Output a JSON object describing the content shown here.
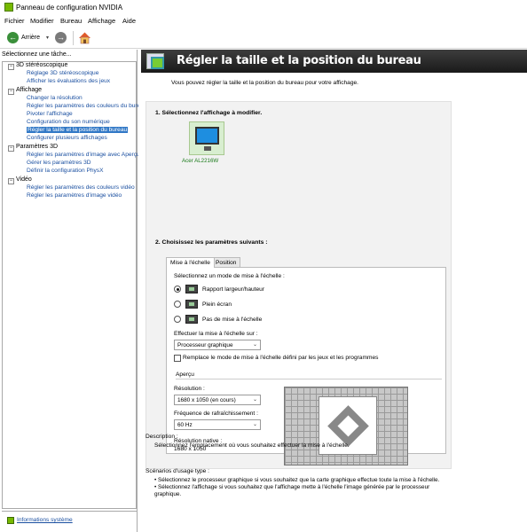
{
  "window": {
    "title": "Panneau de configuration NVIDIA"
  },
  "menu": [
    "Fichier",
    "Modifier",
    "Bureau",
    "Affichage",
    "Aide"
  ],
  "toolbar": {
    "back_label": "Arrière"
  },
  "sidebar": {
    "header": "Sélectionnez une tâche...",
    "categories": [
      {
        "label": "3D stéréoscopique",
        "items": [
          "Réglage 3D stéréoscopique",
          "Afficher les évaluations des jeux"
        ]
      },
      {
        "label": "Affichage",
        "items": [
          "Changer la résolution",
          "Régler les paramètres des couleurs du bureau",
          "Pivoter l'affichage",
          "Configuration du son numérique",
          "Régler la taille et la position du bureau",
          "Configurer plusieurs affichages"
        ]
      },
      {
        "label": "Paramètres 3D",
        "items": [
          "Régler les paramètres d'image avec Aperçu",
          "Gérer les paramètres 3D",
          "Définir la configuration PhysX"
        ]
      },
      {
        "label": "Vidéo",
        "items": [
          "Régler les paramètres des couleurs vidéo",
          "Régler les paramètres d'image vidéo"
        ]
      }
    ],
    "selected_item": "Régler la taille et la position du bureau",
    "system_info": "Informations système"
  },
  "page": {
    "title": "Régler la taille et la position du bureau",
    "description": "Vous pouvez régler la taille et la position du bureau pour votre affichage.",
    "step1": "1. Sélectionnez l'affichage à modifier.",
    "monitor_label": "Acer AL2216W",
    "step2": "2. Choisissez les paramètres suivants :",
    "tabs": [
      "Mise à l'échelle",
      "Position"
    ],
    "active_tab": "Mise à l'échelle",
    "scaling": {
      "mode_prompt": "Sélectionnez un mode de mise à l'échelle :",
      "modes": [
        "Rapport largeur/hauteur",
        "Plein écran",
        "Pas de mise à l'échelle"
      ],
      "selected_mode": "Rapport largeur/hauteur",
      "perform_on_label": "Effectuer la mise à l'échelle sur :",
      "perform_on_value": "Processeur graphique",
      "override_label": "Remplace le mode de mise à l'échelle défini par les jeux et les programmes",
      "override_checked": false,
      "preview_label": "Aperçu",
      "resolution_label": "Résolution :",
      "resolution_value": "1680 x 1050 (en cours)",
      "refresh_label": "Fréquence de rafraîchissement :",
      "refresh_value": "60 Hz",
      "native_label": "Résolution native :",
      "native_value": "1680 x 1050"
    },
    "description_heading": "Description :",
    "description_text": "Sélectionnez l'emplacement où vous souhaitez effectuer la mise à l'échelle.",
    "scenarios_heading": "Scénarios d'usage type :",
    "scenarios": [
      "• Sélectionnez le processeur graphique si vous souhaitez que la carte graphique effectue toute la mise à l'échelle.",
      "• Sélectionnez l'affichage si vous souhaitez que l'affichage mette à l'échelle l'image générée par le processeur graphique."
    ]
  },
  "colors": {
    "header_bg": "#2a2a2a",
    "link": "#1a4fa0",
    "selection": "#3178c6",
    "nvidia_green": "#76b900"
  }
}
